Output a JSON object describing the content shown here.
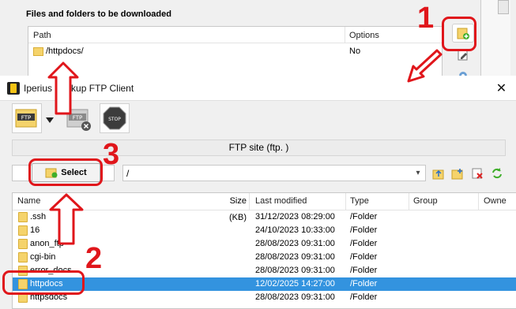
{
  "background_dialog": {
    "section_title": "Files and folders to be downloaded",
    "columns": [
      "Path",
      "Options"
    ],
    "rows": [
      {
        "path": "/httpdocs/",
        "options": "No"
      }
    ]
  },
  "window": {
    "title": "Iperius Backup FTP Client",
    "close_glyph": "✕"
  },
  "toolbar": {
    "connect_label": "FTP",
    "disconnect_label": "FTP",
    "stop_label": "STOP"
  },
  "site_bar": {
    "text": "FTP site  (ftp.                              )"
  },
  "path_row": {
    "select_label": "Select",
    "remote_path": "/"
  },
  "file_table": {
    "columns": {
      "name": "Name",
      "size": "Size (KB)",
      "modified": "Last modified",
      "type": "Type",
      "group": "Group",
      "owner": "Owne"
    },
    "rows": [
      {
        "name": ".ssh",
        "modified": "31/12/2023 08:29:00",
        "type": "/Folder",
        "selected": false
      },
      {
        "name": "16",
        "modified": "24/10/2023 10:33:00",
        "type": "/Folder",
        "selected": false
      },
      {
        "name": "anon_ftp",
        "modified": "28/08/2023 09:31:00",
        "type": "/Folder",
        "selected": false
      },
      {
        "name": "cgi-bin",
        "modified": "28/08/2023 09:31:00",
        "type": "/Folder",
        "selected": false
      },
      {
        "name": "error_docs",
        "modified": "28/08/2023 09:31:00",
        "type": "/Folder",
        "selected": false
      },
      {
        "name": "httpdocs",
        "modified": "12/02/2025 14:27:00",
        "type": "/Folder",
        "selected": true
      },
      {
        "name": "httpsdocs",
        "modified": "28/08/2023 09:31:00",
        "type": "/Folder",
        "selected": false
      }
    ]
  },
  "annotations": {
    "step1": "1",
    "step2": "2",
    "step3": "3",
    "accent": "#e0161b"
  },
  "colors": {
    "selection": "#3393df",
    "folder": "#f5d36b"
  }
}
